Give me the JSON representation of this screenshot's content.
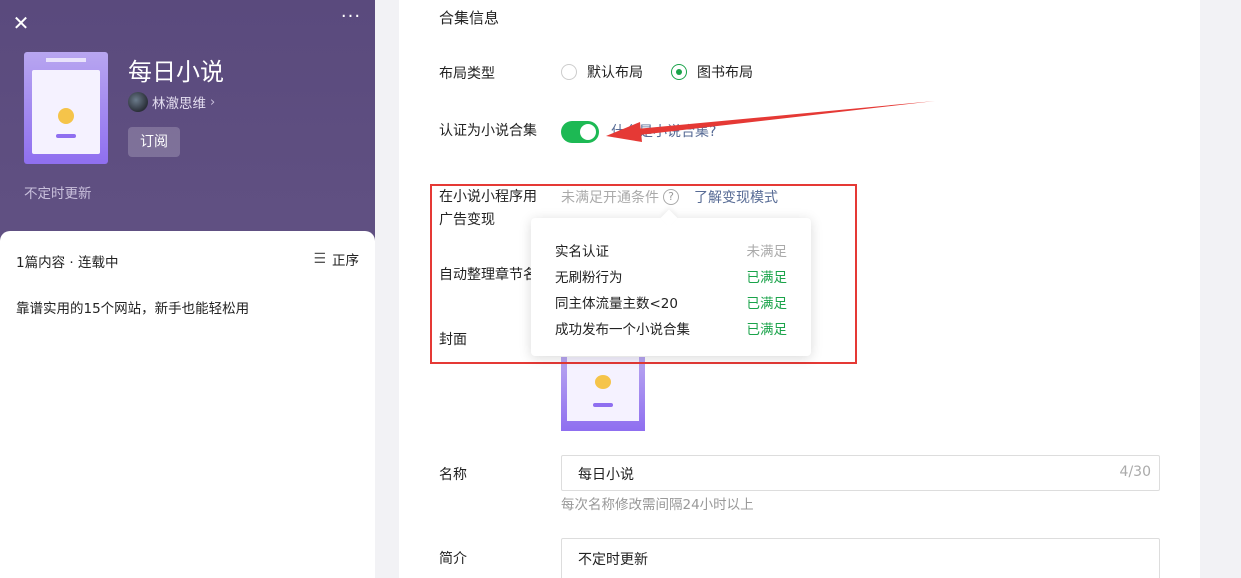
{
  "preview": {
    "close_icon": "close-icon",
    "more_icon": "more-icon",
    "title": "每日小说",
    "author": "林澈思维",
    "subscribe_label": "订阅",
    "update_text": "不定时更新",
    "count_text": "1篇内容 · 连载中",
    "sort_label": "正序",
    "articles": [
      "靠谱实用的15个网站，新手也能轻松用"
    ]
  },
  "form": {
    "section_title": "合集信息",
    "layout_label": "布局类型",
    "layout_options": [
      {
        "label": "默认布局",
        "checked": false
      },
      {
        "label": "图书布局",
        "checked": true
      }
    ],
    "certify_label": "认证为小说合集",
    "certify_on": true,
    "certify_help": "什么是小说合集?",
    "monetize_label_1": "在小说小程序用",
    "monetize_label_2": "广告变现",
    "unmet_text": "未满足开通条件",
    "learn_link": "了解变现模式",
    "auto_chapter_label": "自动整理章节名",
    "cover_label": "封面",
    "name_label": "名称",
    "name_value": "每日小说",
    "name_count": "4/30",
    "name_hint": "每次名称修改需间隔24小时以上",
    "intro_label": "简介",
    "intro_value": "不定时更新"
  },
  "conditions": [
    {
      "label": "实名认证",
      "status": "未满足",
      "met": false
    },
    {
      "label": "无刷粉行为",
      "status": "已满足",
      "met": true
    },
    {
      "label": "同主体流量主数<20",
      "status": "已满足",
      "met": true
    },
    {
      "label": "成功发布一个小说合集",
      "status": "已满足",
      "met": true
    }
  ],
  "colors": {
    "accent_green": "#1aa34a",
    "toggle_green": "#1db954",
    "link_blue": "#576b95",
    "highlight_red": "#e53935",
    "preview_purple": "#5a4a7d"
  }
}
